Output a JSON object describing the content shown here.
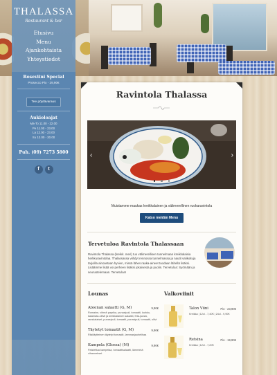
{
  "brand": {
    "name": "THALASSA",
    "tagline": "Restaurant & bar"
  },
  "nav": {
    "items": [
      {
        "label": "Etusivu"
      },
      {
        "label": "Menu"
      },
      {
        "label": "Ajankohtaista"
      },
      {
        "label": "Yhteystiedot"
      }
    ]
  },
  "sidebar": {
    "special_title": "Roseviini Special",
    "special_price": "Prosecco Pio - 29,90€",
    "booking_button": "Tee pöytävaraus",
    "hours_title": "Aukioloajat",
    "hours": [
      "Ma-To 11.00 - 22.00",
      "Pe 11.00 - 23.00",
      "La 12.00 - 23.00",
      "Su 12.00 - 20.00"
    ],
    "phone": "Puh. (09) 7273 5800",
    "social": [
      {
        "icon": "facebook-icon",
        "glyph": "f"
      },
      {
        "icon": "twitter-icon",
        "glyph": "t"
      }
    ]
  },
  "main": {
    "title": "Ravintola Thalassa",
    "slider": {
      "prev_glyph": "‹",
      "next_glyph": "›",
      "dots": 3,
      "active_dot": 0
    },
    "tagline": "Muistamme maukas kreikkalainen ja välimerellinen ruokaravintola",
    "cta_label": "Katso meidän Menu",
    "welcome": {
      "title": "Tervetuloa Ravintola Thalassaan",
      "text": "Ravintola Thalassa (kreikk. meri) tuo välimerellisen tunnelmaan kreikkalaisia herkkuravintolaa. Thalassassa viihdyt rennossa tunnelmassa ja nautit valikoituja tarjoilla ainoastaan hyvien, missä lähes raaka-aineet tuodaan lähellä lisäksi. Lisäämme lisää voi perheen lisäksi jokaisesta ja puolin. Tervetuloa: Syömään ja seurustelemaan. Tervetuloa!"
    },
    "lunch": {
      "title": "Lounas",
      "items": [
        {
          "name": "Ateenan salaatti (G, M)",
          "price": "9,90€",
          "desc": "Romaine, vihreä paprika, punasipuli, tomaatti, kurkku, kalamata-oliivit ja kreikkalainen salaatti, feta-juusto, ranskalaiset, punasipuli, tomaatti, punasipuli, tomaatti, oliivi"
        },
        {
          "name": "Täytetyt tomaatit (G, M)",
          "price": "9,90€",
          "desc": "Riisitäytteinen täytetyt tomaatit, lammasjauhelihaa"
        },
        {
          "name": "Kampela (Glossa) (M)",
          "price": "9,90€",
          "desc": "Paistettua kampelaa, tomaattisalaatti, lämmintä vihannekset"
        }
      ]
    },
    "wines": {
      "title": "Valkoviinit",
      "items": [
        {
          "name": "Talon Viini",
          "price": "Pio - 23,90€",
          "desc": "Kreikka | 12cl - 7,40€ | 24cl - 9,90€"
        },
        {
          "name": "Retsina",
          "price": "Pio - 19,90€",
          "desc": "Kreikka | 12cl - 7,20€"
        }
      ]
    }
  }
}
